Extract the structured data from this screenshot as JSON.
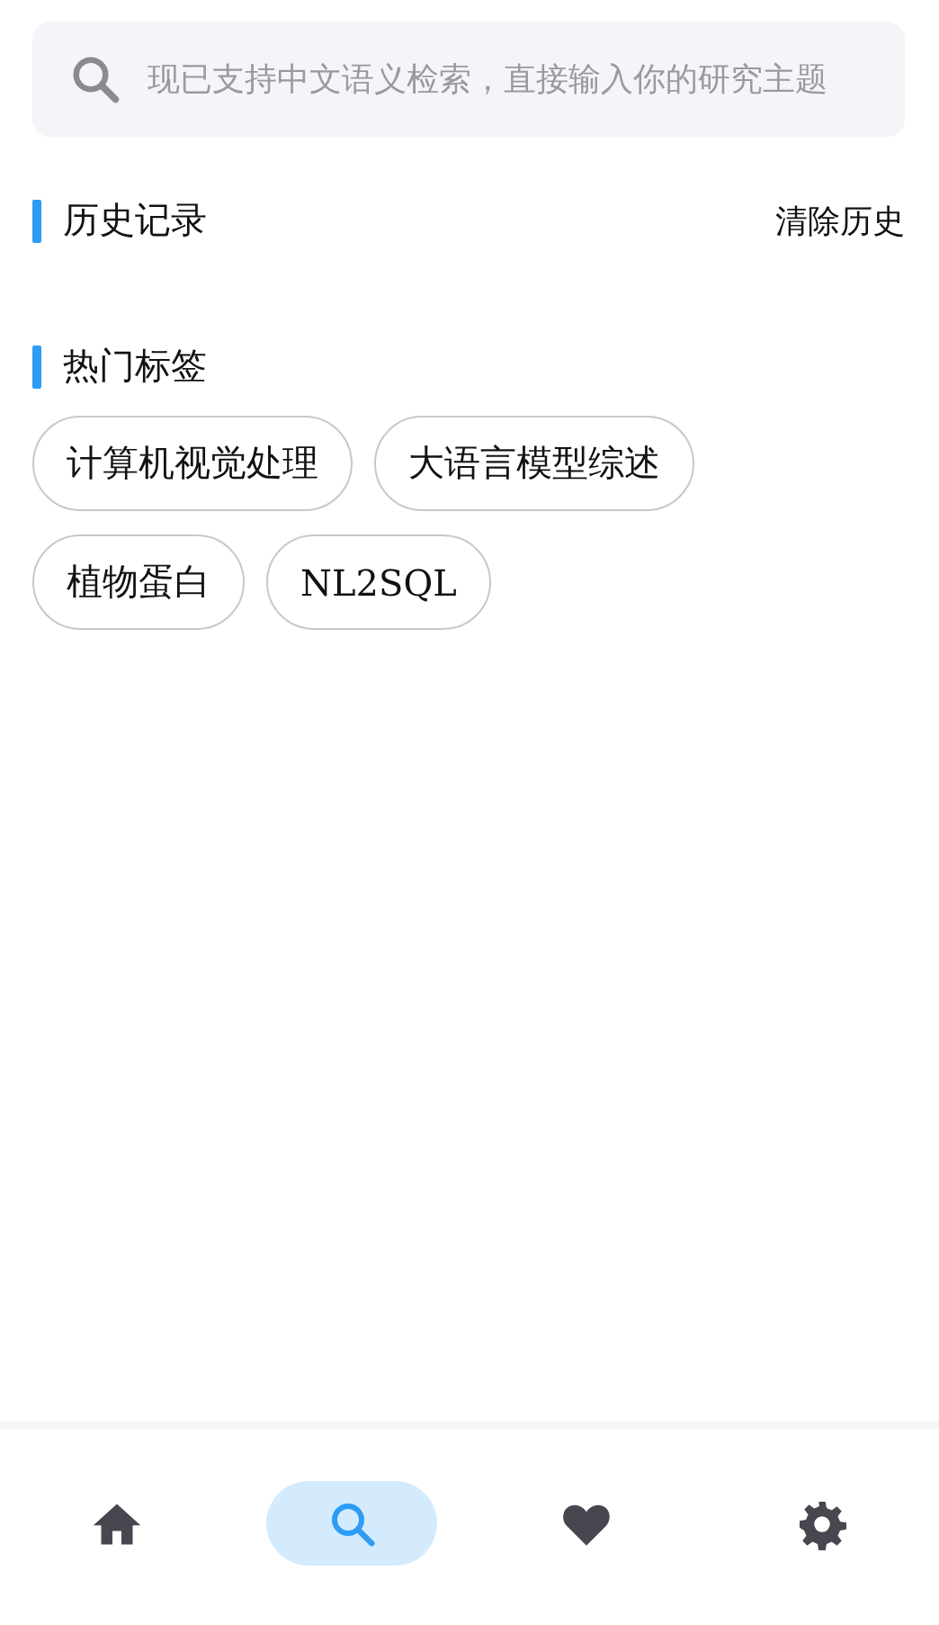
{
  "search": {
    "placeholder": "现已支持中文语义检索，直接输入你的研究主题"
  },
  "history": {
    "title": "历史记录",
    "clear_label": "清除历史"
  },
  "hot_tags": {
    "title": "热门标签",
    "tags": [
      "计算机视觉处理",
      "大语言模型综述",
      "植物蛋白",
      "NL2SQL"
    ]
  },
  "nav": [
    {
      "kind": "home",
      "selected": false
    },
    {
      "kind": "search",
      "selected": true
    },
    {
      "kind": "heart",
      "selected": false
    },
    {
      "kind": "gear",
      "selected": false
    }
  ]
}
